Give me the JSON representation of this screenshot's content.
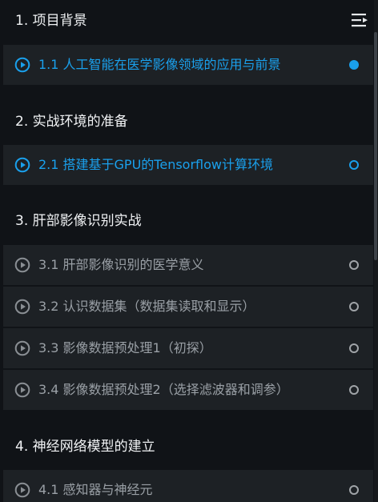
{
  "colors": {
    "accent": "#1aa0ec",
    "panel_bg": "#101317",
    "item_bg": "#1d2125",
    "muted_text": "#9aa0a6",
    "heading_text": "#f1f3f5"
  },
  "header": {
    "menu_icon": "menu-list-icon"
  },
  "chapters": [
    {
      "title": "1. 项目背景",
      "lessons": [
        {
          "label": "1.1 人工智能在医学影像领域的应用与前景",
          "state": "active",
          "status": "filled-dot"
        }
      ]
    },
    {
      "title": "2. 实战环境的准备",
      "lessons": [
        {
          "label": "2.1 搭建基于GPU的Tensorflow计算环境",
          "state": "active",
          "status": "hollow-dot"
        }
      ]
    },
    {
      "title": "3. 肝部影像识别实战",
      "lessons": [
        {
          "label": "3.1 肝部影像识别的医学意义",
          "state": "inactive",
          "status": "hollow-dot"
        },
        {
          "label": "3.2 认识数据集（数据集读取和显示）",
          "state": "inactive",
          "status": "hollow-dot"
        },
        {
          "label": "3.3 影像数据预处理1（初探）",
          "state": "inactive",
          "status": "hollow-dot"
        },
        {
          "label": "3.4 影像数据预处理2（选择滤波器和调参）",
          "state": "inactive",
          "status": "hollow-dot"
        }
      ]
    },
    {
      "title": "4. 神经网络模型的建立",
      "lessons": [
        {
          "label": "4.1 感知器与神经元",
          "state": "inactive",
          "status": "hollow-dot"
        }
      ]
    }
  ]
}
